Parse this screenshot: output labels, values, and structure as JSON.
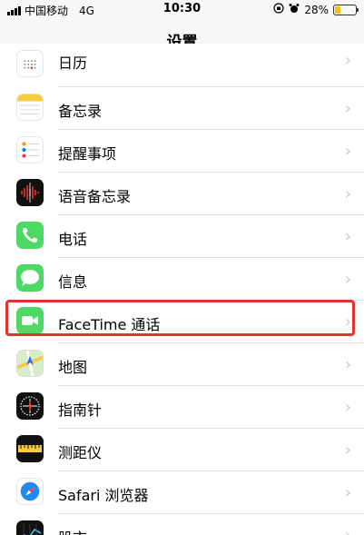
{
  "status_bar": {
    "carrier": "中国移动",
    "network": "4G",
    "time": "10:30",
    "battery": "28%",
    "battery_level": 0.28
  },
  "nav": {
    "title": "设置"
  },
  "rows": [
    {
      "label": "日历",
      "icon": "calendar-icon"
    },
    {
      "label": "备忘录",
      "icon": "notes-icon"
    },
    {
      "label": "提醒事项",
      "icon": "reminders-icon"
    },
    {
      "label": "语音备忘录",
      "icon": "voice-memos-icon"
    },
    {
      "label": "电话",
      "icon": "phone-icon"
    },
    {
      "label": "信息",
      "icon": "messages-icon"
    },
    {
      "label": "FaceTime 通话",
      "icon": "facetime-icon"
    },
    {
      "label": "地图",
      "icon": "maps-icon"
    },
    {
      "label": "指南针",
      "icon": "compass-icon"
    },
    {
      "label": "测距仪",
      "icon": "measure-icon"
    },
    {
      "label": "Safari 浏览器",
      "icon": "safari-icon"
    },
    {
      "label": "股市",
      "icon": "stocks-icon"
    }
  ],
  "chevron": "›",
  "colors": {
    "highlight": "#e0342e",
    "facetime": "#4cd964",
    "phone": "#4cd964",
    "messages": "#4cd964"
  }
}
